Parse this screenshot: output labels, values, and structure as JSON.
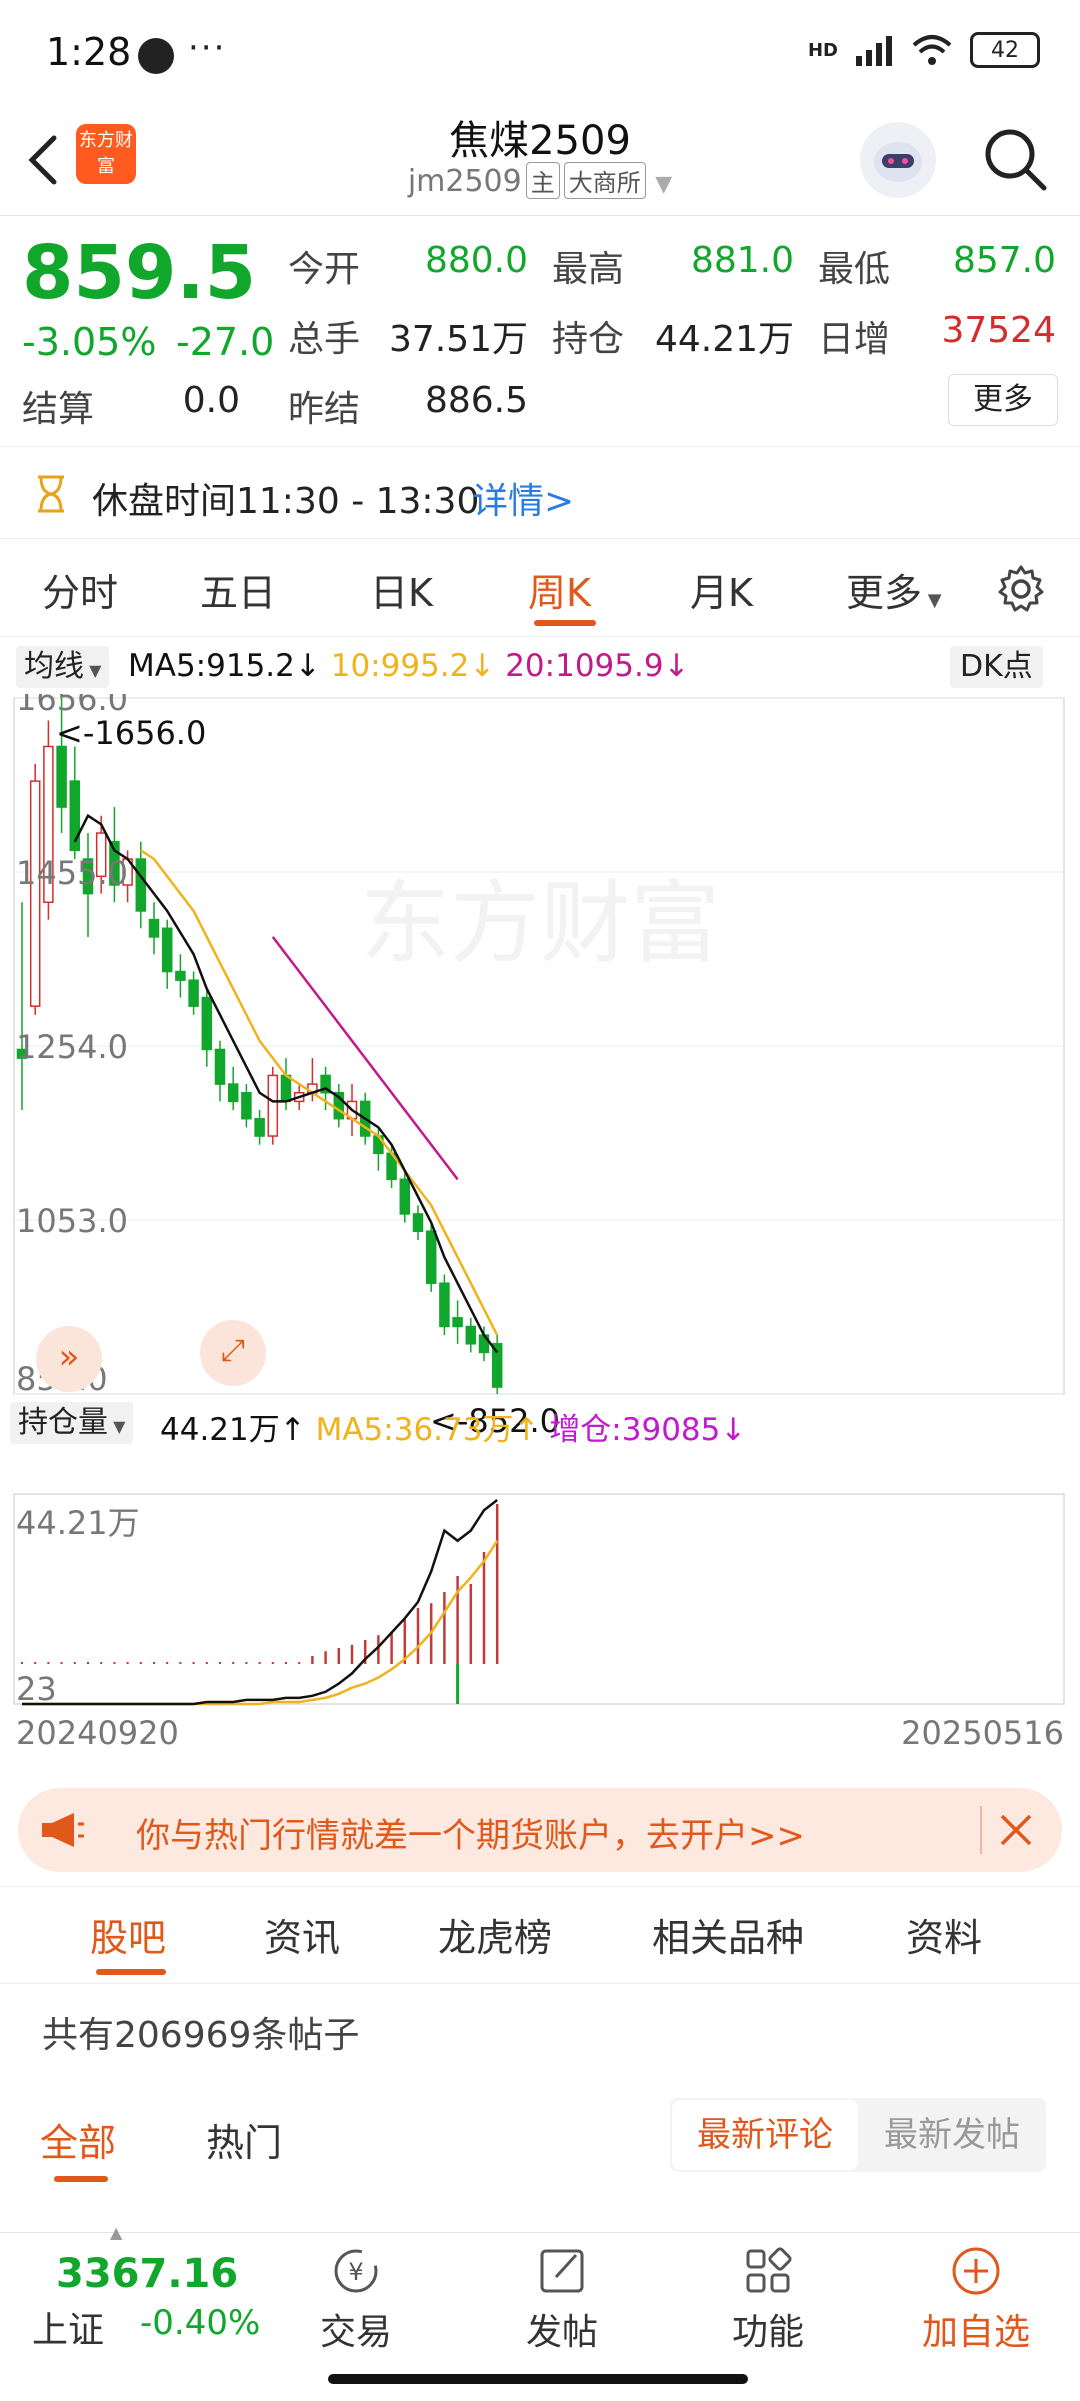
{
  "status": {
    "time": "1:28",
    "battery": "42",
    "network": "HD"
  },
  "header": {
    "logo_text": "东方财富",
    "title": "焦煤2509",
    "code": "jm2509",
    "tag_main": "主",
    "tag_exchange": "大商所"
  },
  "quote": {
    "price": "859.5",
    "change_pct": "-3.05%",
    "change": "-27.0",
    "settle_label": "结算",
    "settle": "0.0",
    "fields": [
      {
        "label": "今开",
        "value": "880.0"
      },
      {
        "label": "最高",
        "value": "881.0"
      },
      {
        "label": "最低",
        "value": "857.0"
      },
      {
        "label": "总手",
        "value": "37.51万"
      },
      {
        "label": "持仓",
        "value": "44.21万"
      },
      {
        "label": "日增",
        "value": "37524"
      },
      {
        "label": "昨结",
        "value": "886.5"
      }
    ],
    "more": "更多"
  },
  "notice": {
    "text": "休盘时间11:30 - 13:30",
    "link": "详情>"
  },
  "period_tabs": [
    "分时",
    "五日",
    "日K",
    "周K",
    "月K",
    "更多"
  ],
  "active_period": "周K",
  "ma_bar": {
    "selector": "均线",
    "ma5": "MA5:915.2",
    "ma10": "10:995.2",
    "ma20": "20:1095.9",
    "dk": "DK点"
  },
  "oi_bar": {
    "selector": "持仓量",
    "oi": "44.21万",
    "ma5": "MA5:36.73万",
    "chg": "增仓:39085"
  },
  "colors": {
    "up": "#d52c2c",
    "down": "#11a62c",
    "accent": "#e0581a",
    "ma5": "#111111",
    "ma10": "#f1b21c",
    "ma20": "#c21a8a",
    "link": "#2a7ce0"
  },
  "chart_data": {
    "type": "candlestick",
    "title": "",
    "y_ticks": [
      "1656.0",
      "1455.0",
      "1254.0",
      "1053.0",
      "852.0"
    ],
    "ylim": [
      852.0,
      1656.0
    ],
    "high_label": "<-1656.0",
    "low_label": "<-852.0",
    "x_start": "20240920",
    "x_end": "20250516",
    "watermark": "东方财富",
    "candles": [
      {
        "o": 1250,
        "c": 1240,
        "h": 1420,
        "l": 1180
      },
      {
        "o": 1300,
        "c": 1560,
        "h": 1580,
        "l": 1290
      },
      {
        "o": 1420,
        "c": 1600,
        "h": 1630,
        "l": 1400
      },
      {
        "o": 1600,
        "c": 1530,
        "h": 1656,
        "l": 1500
      },
      {
        "o": 1560,
        "c": 1480,
        "h": 1600,
        "l": 1470
      },
      {
        "o": 1470,
        "c": 1430,
        "h": 1500,
        "l": 1380
      },
      {
        "o": 1450,
        "c": 1500,
        "h": 1520,
        "l": 1430
      },
      {
        "o": 1490,
        "c": 1440,
        "h": 1530,
        "l": 1420
      },
      {
        "o": 1440,
        "c": 1470,
        "h": 1480,
        "l": 1420
      },
      {
        "o": 1470,
        "c": 1410,
        "h": 1490,
        "l": 1390
      },
      {
        "o": 1400,
        "c": 1380,
        "h": 1420,
        "l": 1360
      },
      {
        "o": 1390,
        "c": 1340,
        "h": 1400,
        "l": 1320
      },
      {
        "o": 1340,
        "c": 1330,
        "h": 1360,
        "l": 1310
      },
      {
        "o": 1330,
        "c": 1300,
        "h": 1340,
        "l": 1290
      },
      {
        "o": 1310,
        "c": 1250,
        "h": 1320,
        "l": 1230
      },
      {
        "o": 1250,
        "c": 1210,
        "h": 1260,
        "l": 1190
      },
      {
        "o": 1210,
        "c": 1190,
        "h": 1230,
        "l": 1180
      },
      {
        "o": 1200,
        "c": 1170,
        "h": 1210,
        "l": 1160
      },
      {
        "o": 1170,
        "c": 1150,
        "h": 1180,
        "l": 1140
      },
      {
        "o": 1150,
        "c": 1220,
        "h": 1230,
        "l": 1140
      },
      {
        "o": 1220,
        "c": 1190,
        "h": 1240,
        "l": 1180
      },
      {
        "o": 1190,
        "c": 1200,
        "h": 1210,
        "l": 1180
      },
      {
        "o": 1200,
        "c": 1210,
        "h": 1240,
        "l": 1190
      },
      {
        "o": 1220,
        "c": 1200,
        "h": 1230,
        "l": 1180
      },
      {
        "o": 1200,
        "c": 1170,
        "h": 1210,
        "l": 1160
      },
      {
        "o": 1170,
        "c": 1190,
        "h": 1210,
        "l": 1150
      },
      {
        "o": 1190,
        "c": 1150,
        "h": 1200,
        "l": 1140
      },
      {
        "o": 1150,
        "c": 1130,
        "h": 1160,
        "l": 1110
      },
      {
        "o": 1130,
        "c": 1100,
        "h": 1140,
        "l": 1090
      },
      {
        "o": 1100,
        "c": 1060,
        "h": 1110,
        "l": 1050
      },
      {
        "o": 1060,
        "c": 1040,
        "h": 1070,
        "l": 1030
      },
      {
        "o": 1040,
        "c": 980,
        "h": 1050,
        "l": 970
      },
      {
        "o": 980,
        "c": 930,
        "h": 990,
        "l": 920
      },
      {
        "o": 940,
        "c": 930,
        "h": 960,
        "l": 910
      },
      {
        "o": 930,
        "c": 910,
        "h": 940,
        "l": 900
      },
      {
        "o": 920,
        "c": 900,
        "h": 930,
        "l": 890
      },
      {
        "o": 910,
        "c": 860,
        "h": 920,
        "l": 852
      }
    ],
    "ma5": [
      null,
      null,
      null,
      null,
      1490,
      1520,
      1510,
      1480,
      1470,
      1450,
      1430,
      1410,
      1385,
      1360,
      1320,
      1290,
      1260,
      1230,
      1200,
      1190,
      1190,
      1195,
      1200,
      1205,
      1195,
      1180,
      1170,
      1160,
      1140,
      1110,
      1080,
      1050,
      1010,
      980,
      950,
      920,
      900
    ],
    "ma10": [
      null,
      null,
      null,
      null,
      null,
      null,
      null,
      null,
      null,
      1480,
      1470,
      1450,
      1430,
      1410,
      1380,
      1350,
      1320,
      1290,
      1260,
      1240,
      1220,
      1210,
      1200,
      1190,
      1180,
      1170,
      1160,
      1150,
      1130,
      1110,
      1090,
      1070,
      1040,
      1010,
      980,
      950,
      920
    ],
    "ma20": [
      null,
      null,
      null,
      null,
      null,
      null,
      null,
      null,
      null,
      null,
      null,
      null,
      null,
      null,
      null,
      null,
      null,
      null,
      null,
      1380,
      1360,
      1340,
      1320,
      1300,
      1280,
      1260,
      1240,
      1220,
      1200,
      1180,
      1160,
      1140,
      1120,
      1100,
      null,
      null,
      null
    ],
    "oi_ticks": [
      "44.21万",
      "23"
    ],
    "oi_bars": [
      0,
      0,
      0,
      0,
      0,
      0,
      0,
      0,
      0,
      0,
      0,
      0,
      0,
      0,
      0,
      0,
      0,
      0,
      0,
      0,
      0,
      0,
      0.05,
      0.08,
      0.1,
      0.12,
      0.15,
      0.18,
      0.2,
      0.28,
      0.35,
      0.38,
      0.45,
      0.55,
      0.5,
      0.7,
      1.0
    ],
    "oi_line": [
      0,
      0,
      0,
      0,
      0,
      0,
      0,
      0,
      0,
      0,
      0,
      0,
      0,
      0,
      0.01,
      0.01,
      0.01,
      0.02,
      0.02,
      0.02,
      0.03,
      0.03,
      0.04,
      0.06,
      0.1,
      0.15,
      0.22,
      0.28,
      0.35,
      0.42,
      0.5,
      0.65,
      0.85,
      0.8,
      0.85,
      0.95,
      1.0
    ],
    "oi_ma": [
      0,
      0,
      0,
      0,
      0,
      0,
      0,
      0,
      0,
      0,
      0,
      0,
      0,
      0,
      0,
      0,
      0,
      0,
      0,
      0.01,
      0.01,
      0.01,
      0.02,
      0.03,
      0.05,
      0.08,
      0.1,
      0.13,
      0.17,
      0.22,
      0.28,
      0.35,
      0.45,
      0.55,
      0.62,
      0.7,
      0.8
    ]
  },
  "banner": {
    "text": "你与热门行情就差一个期货账户，去开户>>"
  },
  "info_tabs": [
    "股吧",
    "资讯",
    "龙虎榜",
    "相关品种",
    "资料"
  ],
  "post_count": "共有206969条帖子",
  "filter_tabs": [
    "全部",
    "热门"
  ],
  "sort_tabs": [
    "最新评论",
    "最新发帖"
  ],
  "bottom": {
    "index_value": "3367.16",
    "index_name": "上证",
    "index_change": "-0.40%",
    "nav": [
      "交易",
      "发帖",
      "功能",
      "加自选"
    ]
  }
}
